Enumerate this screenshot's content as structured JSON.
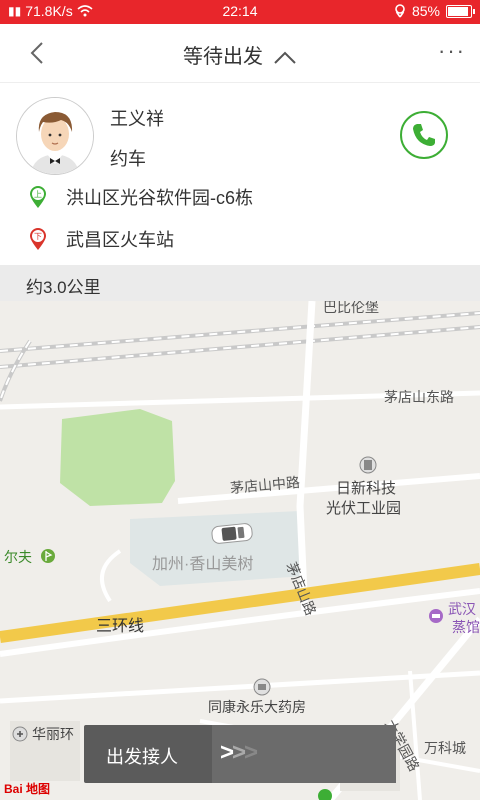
{
  "status_bar": {
    "speed": "71.8K/s",
    "time": "22:14",
    "battery": "85%",
    "battery_level": 0.85
  },
  "header": {
    "title": "等待出发",
    "more": "···"
  },
  "passenger": {
    "name": "王义祥",
    "order_type": "约车",
    "pickup_badge": "上",
    "pickup": "洪山区光谷软件园-c6栋",
    "dropoff_badge": "下",
    "dropoff": "武昌区火车站"
  },
  "distance": "约3.0公里",
  "map": {
    "labels": {
      "top_cut": "巴比伦堡",
      "road_maodian_east": "茅店山东路",
      "road_maodian_mid": "茅店山中路",
      "risheng": "日新科技",
      "solar_park": "光伏工业园",
      "golf": "尔夫",
      "jiazhou": "加州·香山美树",
      "road_maodian": "茅店山路",
      "ring_road": "三环线",
      "wuhan1": "武汉",
      "wuhan2": "蒸馆",
      "pharmacy": "同康永乐大药房",
      "huali": "华丽环",
      "daxue": "大学园路",
      "vanke": "万科城"
    },
    "logo": "Bai 地图"
  },
  "action": {
    "depart_label": "出发接人",
    "arrows": ">>>"
  },
  "colors": {
    "status_red": "#e8262b",
    "call_green": "#3dae35",
    "pickup_green": "#3dae35",
    "dropoff_red": "#d9342b",
    "ring_road": "#f2c94a"
  }
}
